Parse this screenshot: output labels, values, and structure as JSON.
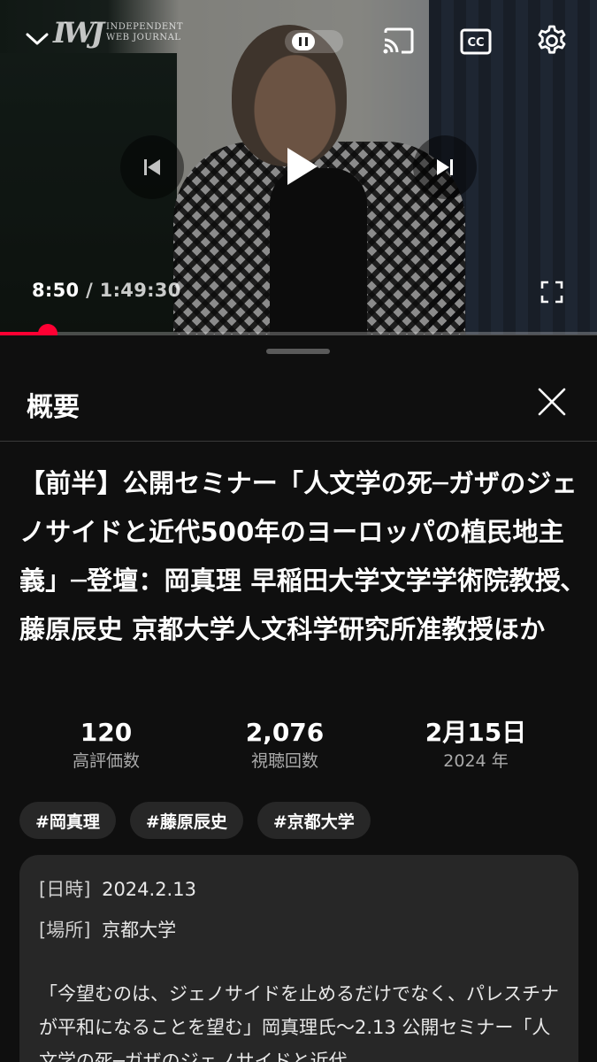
{
  "player": {
    "logo_mark": "IWJ",
    "logo_line1": "INDEPENDENT",
    "logo_line2": "WEB JOURNAL",
    "time_current": "8:50",
    "time_separator": "/",
    "time_total": "1:49:30",
    "progress_fraction": 0.08,
    "icons": [
      "chevron-down-icon",
      "pause-icon",
      "cast-icon",
      "closed-captions-icon",
      "settings-gear-icon",
      "previous-icon",
      "play-icon",
      "next-icon",
      "fullscreen-icon"
    ],
    "accent_color": "#ff0033"
  },
  "sheet": {
    "title": "概要",
    "video_title": "【前半】公開セミナー「人文学の死─ガザのジェノサイドと近代500年のヨーロッパの植民地主義」─登壇：岡真理 早稲田大学文学学術院教授､藤原辰史 京都大学人文科学研究所准教授ほか",
    "stats": [
      {
        "value": "120",
        "label": "高評価数"
      },
      {
        "value": "2,076",
        "label": "視聴回数"
      },
      {
        "value": "2月15日",
        "label": "2024 年"
      }
    ],
    "hashtags": [
      "#岡真理",
      "#藤原辰史",
      "#京都大学"
    ],
    "description": {
      "date_key": "[日時]",
      "date_value": "2024.2.13",
      "place_key": "[場所]",
      "place_value": "京都大学",
      "body": "「今望むのは、ジェノサイドを止めるだけでなく、パレスチナが平和になることを望む」岡真理氏〜2.13 公開セミナー「人文学の死─ガザのジェノサイドと近代"
    }
  }
}
